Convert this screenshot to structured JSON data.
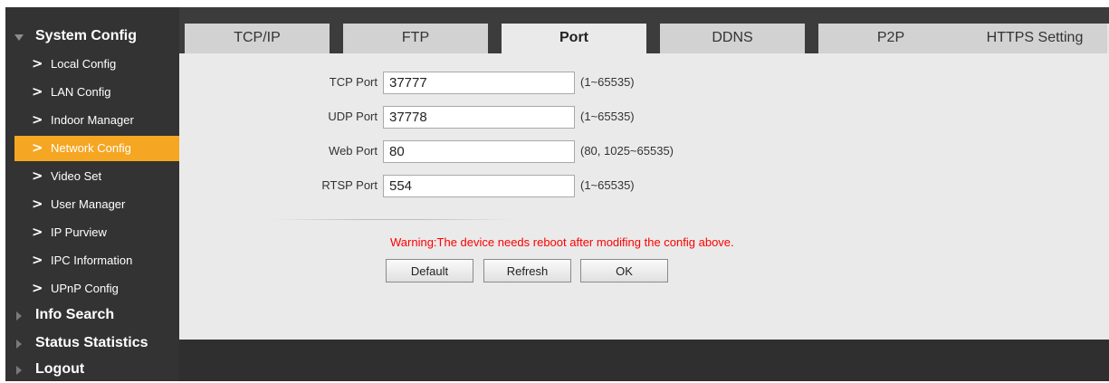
{
  "sidebar": {
    "system_config": "System Config",
    "items": [
      {
        "label": "Local Config"
      },
      {
        "label": "LAN Config"
      },
      {
        "label": "Indoor Manager"
      },
      {
        "label": "Network Config"
      },
      {
        "label": "Video Set"
      },
      {
        "label": "User Manager"
      },
      {
        "label": "IP Purview"
      },
      {
        "label": "IPC Information"
      },
      {
        "label": "UPnP Config"
      }
    ],
    "active_item": "Network Config",
    "chevron": ">",
    "info_search": "Info Search",
    "status_statistics": "Status Statistics",
    "logout": "Logout"
  },
  "tabs": [
    {
      "label": "TCP/IP"
    },
    {
      "label": "FTP"
    },
    {
      "label": "Port"
    },
    {
      "label": "DDNS"
    },
    {
      "label": "P2P"
    },
    {
      "label": "HTTPS Setting"
    }
  ],
  "active_tab": "Port",
  "form": {
    "tcp": {
      "label": "TCP Port",
      "value": "37777",
      "range": "(1~65535)"
    },
    "udp": {
      "label": "UDP Port",
      "value": "37778",
      "range": "(1~65535)"
    },
    "web": {
      "label": "Web Port",
      "value": "80",
      "range": "(80, 1025~65535)"
    },
    "rtsp": {
      "label": "RTSP Port",
      "value": "554",
      "range": "(1~65535)"
    }
  },
  "warning": "Warning:The device needs reboot after modifing the config above.",
  "buttons": {
    "default": "Default",
    "refresh": "Refresh",
    "ok": "OK"
  },
  "colors": {
    "accent": "#f5a623",
    "warning": "#ff0000",
    "sidebar_bg": "#333333",
    "content_bg": "#eaeaea"
  }
}
